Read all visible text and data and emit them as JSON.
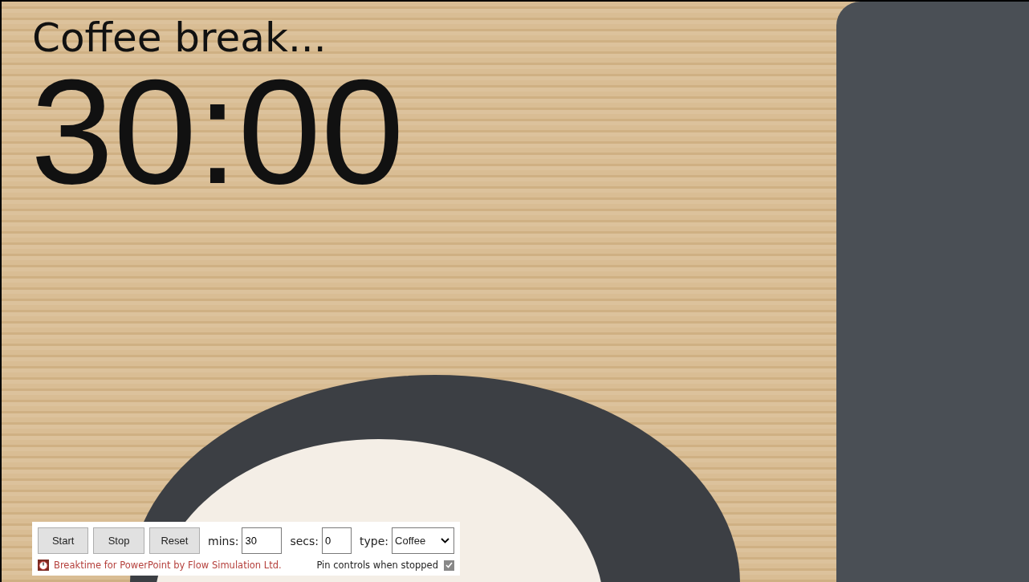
{
  "title": "Coffee break...",
  "timer": "30:00",
  "controls": {
    "buttons": [
      {
        "label": "Start"
      },
      {
        "label": "Stop"
      },
      {
        "label": "Reset"
      }
    ],
    "mins": {
      "label": "mins:",
      "value": "30"
    },
    "secs": {
      "label": "secs:",
      "value": "0"
    },
    "type": {
      "label": "type:",
      "value": "Coffee"
    },
    "credit": "Breaktime for PowerPoint by Flow Simulation Ltd.",
    "pin": {
      "label": "Pin controls when stopped",
      "checked": true
    }
  }
}
